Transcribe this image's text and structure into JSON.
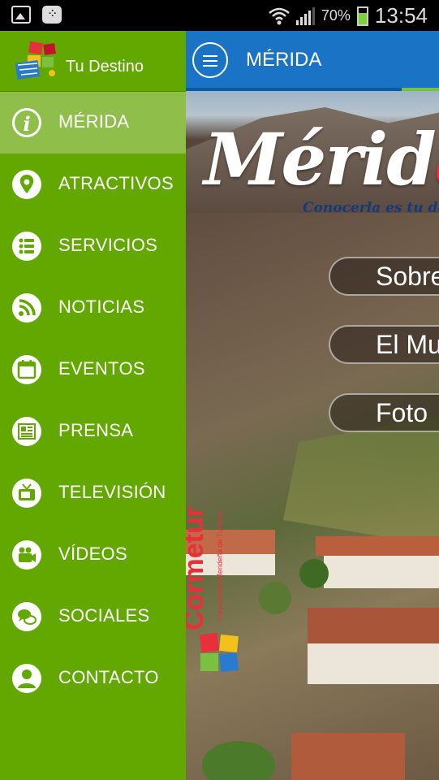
{
  "status_bar": {
    "battery_percent": "70%",
    "time": "13:54",
    "icons": [
      "image-icon",
      "bbm-icon",
      "wifi-icon",
      "signal-icon",
      "battery-icon"
    ]
  },
  "drawer": {
    "app_name": "Tu Destino",
    "items": [
      {
        "label": "MÉRIDA",
        "icon": "info-icon",
        "active": true
      },
      {
        "label": "ATRACTIVOS",
        "icon": "location-pin-icon",
        "active": false
      },
      {
        "label": "SERVICIOS",
        "icon": "list-icon",
        "active": false
      },
      {
        "label": "NOTICIAS",
        "icon": "rss-icon",
        "active": false
      },
      {
        "label": "EVENTOS",
        "icon": "calendar-icon",
        "active": false
      },
      {
        "label": "PRENSA",
        "icon": "newspaper-icon",
        "active": false
      },
      {
        "label": "TELEVISIÓN",
        "icon": "tv-icon",
        "active": false
      },
      {
        "label": "VÍDEOS",
        "icon": "video-camera-icon",
        "active": false
      },
      {
        "label": "SOCIALES",
        "icon": "chat-bubbles-icon",
        "active": false
      },
      {
        "label": "CONTACTO",
        "icon": "person-icon",
        "active": false
      }
    ]
  },
  "action_bar": {
    "title": "MÉRIDA"
  },
  "hero": {
    "logo_text_main": "Mérid",
    "logo_text_accent": "a",
    "slogan": "Conocerla es tu destin",
    "buttons": [
      "Sobre",
      "El Mu",
      "Foto"
    ],
    "sponsor": "Cormetur",
    "sponsor_sub": "Corporación Merideña de Turismo"
  },
  "colors": {
    "drawer_bg": "#62a800",
    "drawer_active": "#8fbe4a",
    "action_bar": "#1a73c4",
    "accent_green": "#7ac142",
    "logo_red": "#e8303a",
    "slogan_blue": "#133a7a"
  }
}
